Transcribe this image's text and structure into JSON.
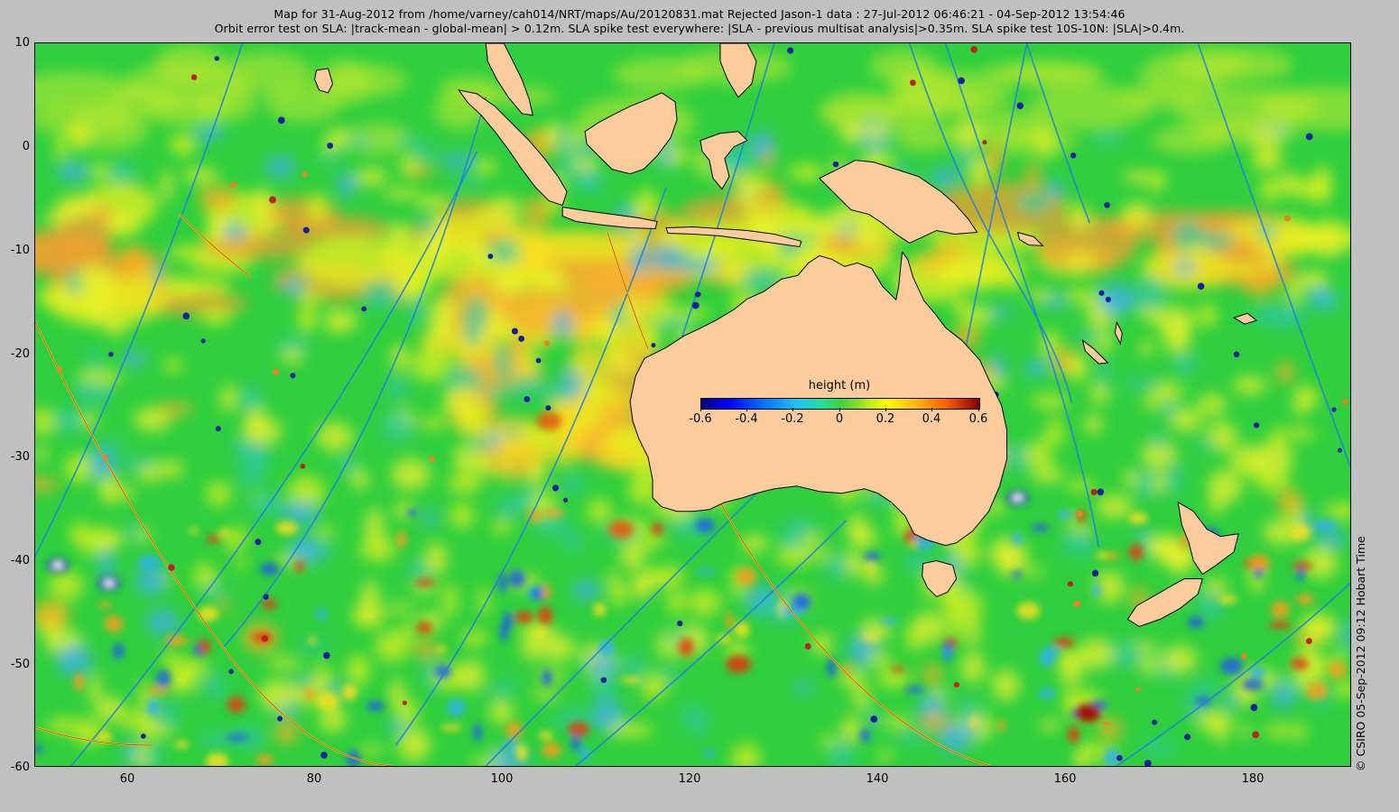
{
  "header": {
    "title_line1": "Map for 31-Aug-2012 from /home/varney/cah014/NRT/maps/Au/20120831.mat  Rejected Jason-1 data : 27-Jul-2012 06:46:21 - 04-Sep-2012 13:54:46",
    "title_line2": "Orbit error test on SLA: |track-mean  - global-mean| > 0.12m.  SLA spike test everywhere: |SLA - previous multisat analysis|>0.35m. SLA spike test 10S-10N: |SLA|>0.4m."
  },
  "map": {
    "lon_range": [
      50,
      190
    ],
    "lat_range": [
      -60,
      10
    ],
    "x_ticks": [
      "60",
      "80",
      "100",
      "120",
      "140",
      "160",
      "180"
    ],
    "y_ticks": [
      "10",
      "0",
      "-10",
      "-20",
      "-30",
      "-40",
      "-50",
      "-60"
    ],
    "land_color": "#fccc9c",
    "ocean_base_color": "#2fcf3f"
  },
  "colorbar": {
    "title": "height (m)",
    "ticks": [
      "-0.6",
      "-0.4",
      "-0.2",
      "0",
      "0.2",
      "0.4",
      "0.6"
    ],
    "range": [
      -0.6,
      0.6
    ]
  },
  "credit": "© CSIRO 05-Sep-2012 09:12 Hobart Time"
}
